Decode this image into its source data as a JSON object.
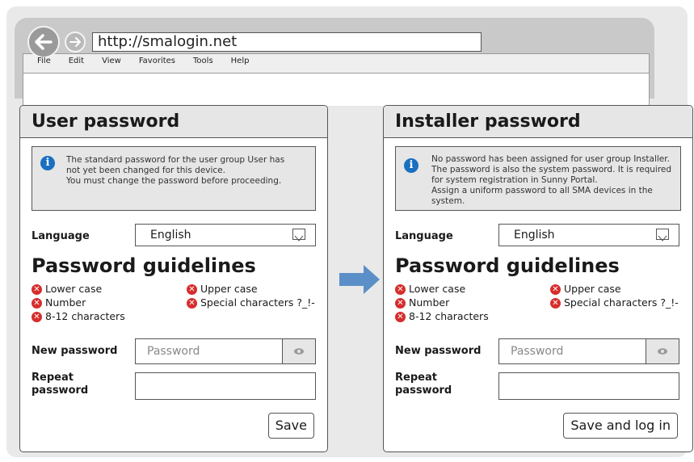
{
  "browser": {
    "url": "http://smalogin.net",
    "menu": [
      "File",
      "Edit",
      "View",
      "Favorites",
      "Tools",
      "Help"
    ]
  },
  "panels": [
    {
      "title": "User password",
      "info_lines": [
        "The standard password for the user group User has",
        "not yet been changed for this device.",
        "You must change the password before proceeding."
      ],
      "language_label": "Language",
      "language_value": "English",
      "guidelines_title": "Password guidelines",
      "rules": [
        "Lower case",
        "Upper case",
        "Number",
        "Special characters ?_!-",
        "8-12 characters"
      ],
      "new_password_label": "New password",
      "new_password_placeholder": "Password",
      "repeat_label_1": "Repeat",
      "repeat_label_2": "password",
      "button": "Save"
    },
    {
      "title": "Installer password",
      "info_lines": [
        "No password has been assigned for user group Installer.",
        "The password is also the system password. It is required",
        "for system registration in Sunny Portal.",
        "Assign a uniform password to all SMA devices in the system."
      ],
      "language_label": "Language",
      "language_value": "English",
      "guidelines_title": "Password guidelines",
      "rules": [
        "Lower case",
        "Upper case",
        "Number",
        "Special characters ?_!-",
        "8-12 characters"
      ],
      "new_password_label": "New password",
      "new_password_placeholder": "Password",
      "repeat_label_1": "Repeat",
      "repeat_label_2": "password",
      "button": "Save and log in"
    }
  ],
  "colors": {
    "info_icon": "#1a6fc0",
    "error_icon": "#d62d2d",
    "arrow": "#5b8fc7"
  }
}
